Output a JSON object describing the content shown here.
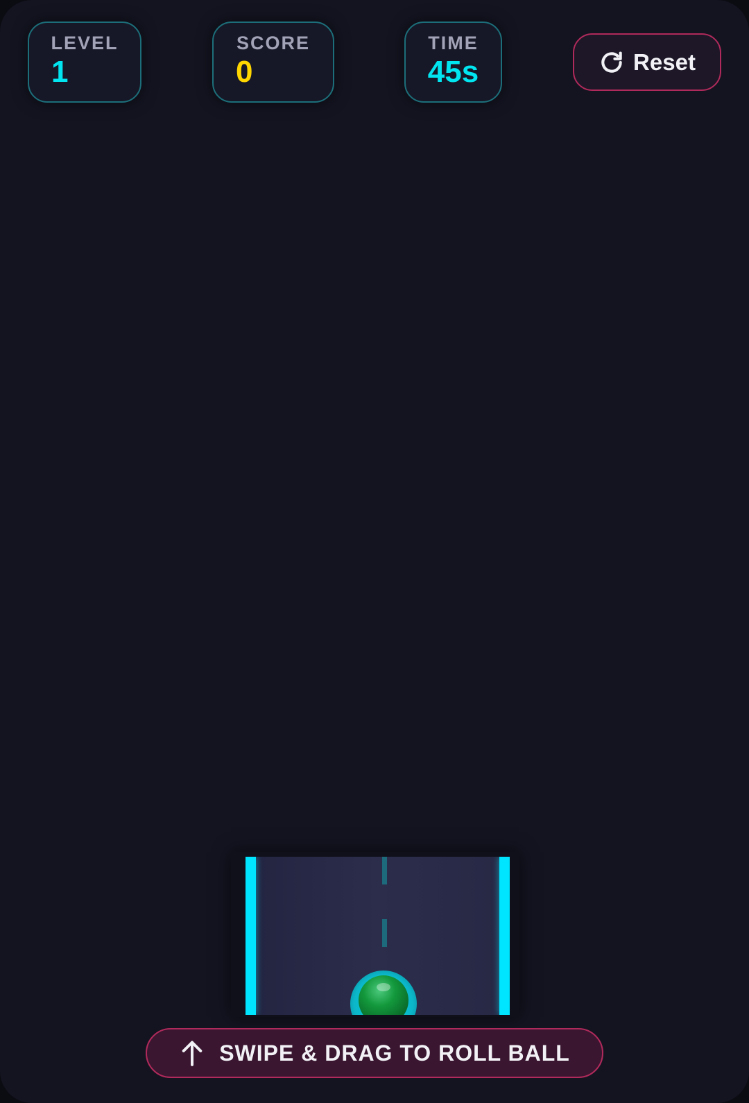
{
  "hud": {
    "level": {
      "label": "LEVEL",
      "value": "1"
    },
    "score": {
      "label": "SCORE",
      "value": "0"
    },
    "time": {
      "label": "TIME",
      "value": "45s"
    }
  },
  "reset_button": {
    "label": "Reset",
    "icon": "refresh-icon"
  },
  "hint": {
    "label": "SWIPE & DRAG TO ROLL BALL",
    "icon": "arrow-up-icon"
  },
  "colors": {
    "background": "#141421",
    "accent_cyan": "#00e5ff",
    "score_yellow": "#ffd600",
    "button_border": "#b02a5b",
    "ball_green": "#13983c"
  }
}
